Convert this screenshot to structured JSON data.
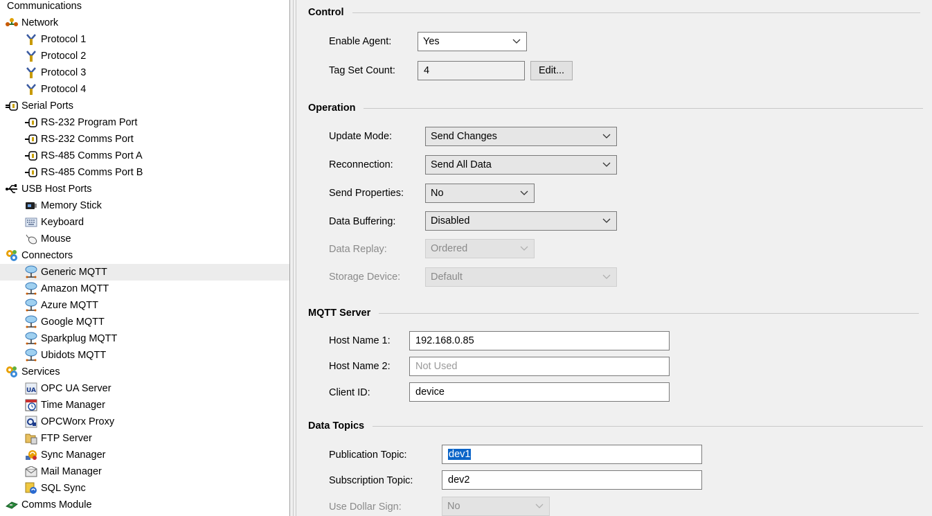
{
  "tree": {
    "items": [
      {
        "label": "Communications",
        "icon": "none"
      },
      {
        "label": "Network",
        "icon": "network-icon"
      },
      {
        "label": "Protocol 1",
        "icon": "protocol-icon"
      },
      {
        "label": "Protocol 2",
        "icon": "protocol-icon"
      },
      {
        "label": "Protocol 3",
        "icon": "protocol-icon"
      },
      {
        "label": "Protocol 4",
        "icon": "protocol-icon"
      },
      {
        "label": "Serial Ports",
        "icon": "serial-port-icon"
      },
      {
        "label": "RS-232 Program Port",
        "icon": "serial-port-icon"
      },
      {
        "label": "RS-232 Comms Port",
        "icon": "serial-port-icon"
      },
      {
        "label": "RS-485 Comms Port A",
        "icon": "serial-port-icon"
      },
      {
        "label": "RS-485 Comms Port B",
        "icon": "serial-port-icon"
      },
      {
        "label": "USB Host Ports",
        "icon": "usb-icon"
      },
      {
        "label": "Memory Stick",
        "icon": "memory-stick-icon"
      },
      {
        "label": "Keyboard",
        "icon": "keyboard-icon"
      },
      {
        "label": "Mouse",
        "icon": "mouse-icon"
      },
      {
        "label": "Connectors",
        "icon": "connectors-icon"
      },
      {
        "label": "Generic MQTT",
        "icon": "cloud-mqtt-icon"
      },
      {
        "label": "Amazon MQTT",
        "icon": "cloud-mqtt-icon"
      },
      {
        "label": "Azure MQTT",
        "icon": "cloud-mqtt-icon"
      },
      {
        "label": "Google MQTT",
        "icon": "cloud-mqtt-icon"
      },
      {
        "label": "Sparkplug MQTT",
        "icon": "cloud-mqtt-icon"
      },
      {
        "label": "Ubidots MQTT",
        "icon": "cloud-mqtt-icon"
      },
      {
        "label": "Services",
        "icon": "services-icon"
      },
      {
        "label": "OPC UA Server",
        "icon": "opc-ua-icon"
      },
      {
        "label": "Time Manager",
        "icon": "calendar-clock-icon"
      },
      {
        "label": "OPCWorx Proxy",
        "icon": "opcworx-icon"
      },
      {
        "label": "FTP Server",
        "icon": "ftp-server-icon"
      },
      {
        "label": "Sync Manager",
        "icon": "sync-manager-icon"
      },
      {
        "label": "Mail Manager",
        "icon": "mail-icon"
      },
      {
        "label": "SQL Sync",
        "icon": "sql-sync-icon"
      },
      {
        "label": "Comms Module",
        "icon": "comms-module-icon"
      }
    ],
    "selected": "Generic MQTT"
  },
  "control": {
    "title": "Control",
    "enable_agent_label": "Enable Agent:",
    "enable_agent_value": "Yes",
    "tag_set_count_label": "Tag Set Count:",
    "tag_set_count_value": "4",
    "edit_button": "Edit..."
  },
  "operation": {
    "title": "Operation",
    "update_mode_label": "Update Mode:",
    "update_mode_value": "Send Changes",
    "reconnection_label": "Reconnection:",
    "reconnection_value": "Send All Data",
    "send_properties_label": "Send Properties:",
    "send_properties_value": "No",
    "data_buffering_label": "Data Buffering:",
    "data_buffering_value": "Disabled",
    "data_replay_label": "Data Replay:",
    "data_replay_value": "Ordered",
    "storage_device_label": "Storage Device:",
    "storage_device_value": "Default"
  },
  "mqtt_server": {
    "title": "MQTT Server",
    "host1_label": "Host Name 1:",
    "host1_value": "192.168.0.85",
    "host2_label": "Host Name 2:",
    "host2_placeholder": "Not Used",
    "client_id_label": "Client ID:",
    "client_id_value": "device"
  },
  "data_topics": {
    "title": "Data Topics",
    "publication_label": "Publication Topic:",
    "publication_value": "dev1",
    "subscription_label": "Subscription Topic:",
    "subscription_value": "dev2",
    "dollar_label": "Use Dollar Sign:",
    "dollar_value": "No"
  },
  "colors": {
    "selection_highlight": "#0a64c8",
    "selected_row": "#ececec",
    "panel_bg": "#f0f0f0"
  }
}
